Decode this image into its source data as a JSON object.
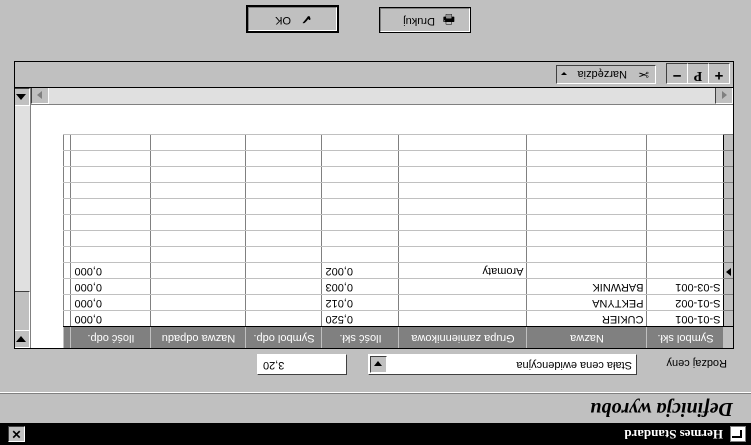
{
  "window": {
    "title": "Hermes Standard",
    "close_glyph": "✕",
    "icon": "system-menu-icon"
  },
  "form": {
    "heading": "Definicja wyrobu"
  },
  "price": {
    "label": "Rodzaj ceny",
    "selected": "Stała cena ewidencyjna",
    "value": "3,20"
  },
  "grid": {
    "columns": [
      "Symbol skł.",
      "Nazwa",
      "Grupa zamiennikowa",
      "Ilość skł.",
      "Symbol odp.",
      "Nazwa odpadu",
      "Ilość odp."
    ],
    "rows": [
      {
        "symbol": "S-01-001",
        "nazwa": "CUKIER",
        "grupa": "",
        "ilosc": "0,520",
        "symbol_odp": "",
        "nazwa_odp": "",
        "ilosc_odp": "0,000"
      },
      {
        "symbol": "S-01-002",
        "nazwa": "PEKTYNA",
        "grupa": "",
        "ilosc": "0,012",
        "symbol_odp": "",
        "nazwa_odp": "",
        "ilosc_odp": "0,000"
      },
      {
        "symbol": "S-03-001",
        "nazwa": "BARWNIK",
        "grupa": "",
        "ilosc": "0,003",
        "symbol_odp": "",
        "nazwa_odp": "",
        "ilosc_odp": "0,000"
      },
      {
        "symbol": "",
        "nazwa": "",
        "grupa": "Aromaty",
        "ilosc": "0,002",
        "symbol_odp": "",
        "nazwa_odp": "",
        "ilosc_odp": "0,000"
      }
    ],
    "empty_rows": 8
  },
  "toolbar": {
    "add_glyph": "+",
    "p_glyph": "P",
    "remove_glyph": "−",
    "tools_label": "Narzędzia",
    "tools_icon": "tools-icon"
  },
  "buttons": {
    "print_label": "Drukuj",
    "print_icon": "printer-icon",
    "ok_label": "OK",
    "ok_icon": "check-icon"
  }
}
